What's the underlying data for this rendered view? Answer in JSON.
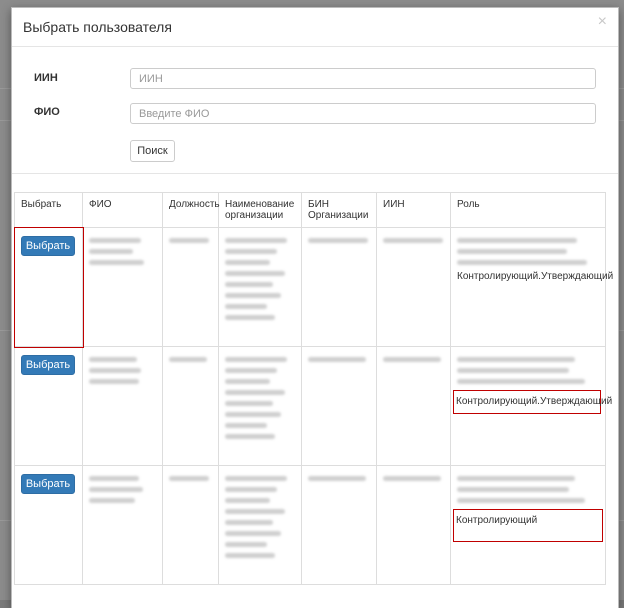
{
  "modal": {
    "title": "Выбрать пользователя",
    "close_label": "×"
  },
  "form": {
    "iin_label": "ИИН",
    "iin_placeholder": "ИИН",
    "fio_label": "ФИО",
    "fio_placeholder": "Введите ФИО",
    "search_label": "Поиск"
  },
  "table": {
    "headers": {
      "select": "Выбрать",
      "fio": "ФИО",
      "position": "Должность",
      "org_name": "Наименование организации",
      "bin": "БИН Организации",
      "iin": "ИИН",
      "role": "Роль"
    },
    "rows": [
      {
        "select_label": "Выбрать",
        "role_visible": "Контролирующий.Утверждающий"
      },
      {
        "select_label": "Выбрать",
        "role_visible": "Контролирующий.Утверждающий"
      },
      {
        "select_label": "Выбрать",
        "role_visible": "Контролирующий"
      }
    ]
  }
}
